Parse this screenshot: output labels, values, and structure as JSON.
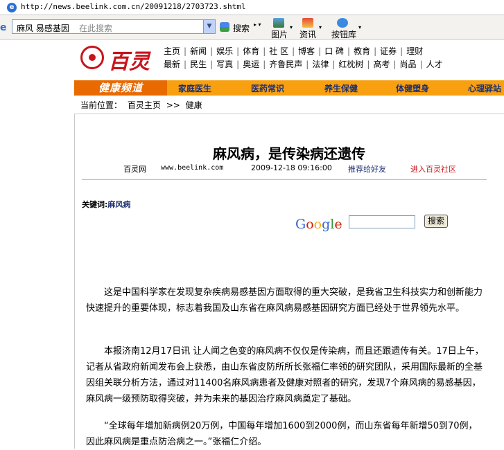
{
  "browser": {
    "url": "http://news.beelink.com.cn/20091218/2703723.shtml"
  },
  "toolbar": {
    "search_terms": "麻风  易感基因",
    "search_placeholder": "在此搜索",
    "search_button": "搜索",
    "images_button": "图片",
    "news_button": "资讯",
    "buttons_lib": "按钮库"
  },
  "site": {
    "logo_text": "百灵",
    "nav_row1": [
      "主页",
      "新闻",
      "娱乐",
      "体育",
      "社  区",
      "博客",
      "口  碑",
      "教育",
      "证券",
      "理财"
    ],
    "nav_row2": [
      "最新",
      "民生",
      "写真",
      "奥运",
      "齐鲁民声",
      "法律",
      "红枕树",
      "高考",
      "尚品",
      "人才"
    ],
    "channel_title": "健康频道",
    "channel_items": [
      "家庭医生",
      "医药常识",
      "养生保健",
      "体健塑身",
      "心理驿站"
    ]
  },
  "breadcrumb": {
    "prefix": "当前位置：",
    "home": "百灵主页",
    "sep": ">>",
    "current": "健康"
  },
  "article": {
    "title": "麻风病，是传染病还遗传",
    "source": "百灵网",
    "source_url": "www.beelink.com",
    "datetime": "2009-12-18 09:16:00",
    "share_link": "推荐给好友",
    "community_link": "进入百灵社区",
    "keywords_label": "关键词:",
    "keywords_value": "麻风病",
    "google_label": "Google",
    "google_search_button": "搜索",
    "paragraphs": [
      "这是中国科学家在发现复杂疾病易感基因方面取得的重大突破，是我省卫生科技实力和创新能力快速提升的重要体现，标志着我国及山东省在麻风病易感基因研究方面已经处于世界领先水平。",
      "本报济南12月17日讯 让人闻之色变的麻风病不仅仅是传染病，而且还跟遗传有关。17日上午，记者从省政府新闻发布会上获悉，由山东省皮防所所长张福仁率领的研究团队，采用国际最新的全基因组关联分析方法，通过对11400名麻风病患者及健康对照者的研究，发现7个麻风病的易感基因，麻风病一级预防取得突破，并为未来的基因治疗麻风病奠定了基础。",
      "“全球每年增加新病例20万例，中国每年增加1600到2000例，而山东省每年新增50到70例，因此麻风病是重点防治病之一。”张福仁介绍。"
    ]
  },
  "colors": {
    "channel_bar": "#f8a010",
    "channel_title_bg": "#e86a00",
    "link_red": "#c8141b",
    "link_blue": "#1c2f72"
  }
}
